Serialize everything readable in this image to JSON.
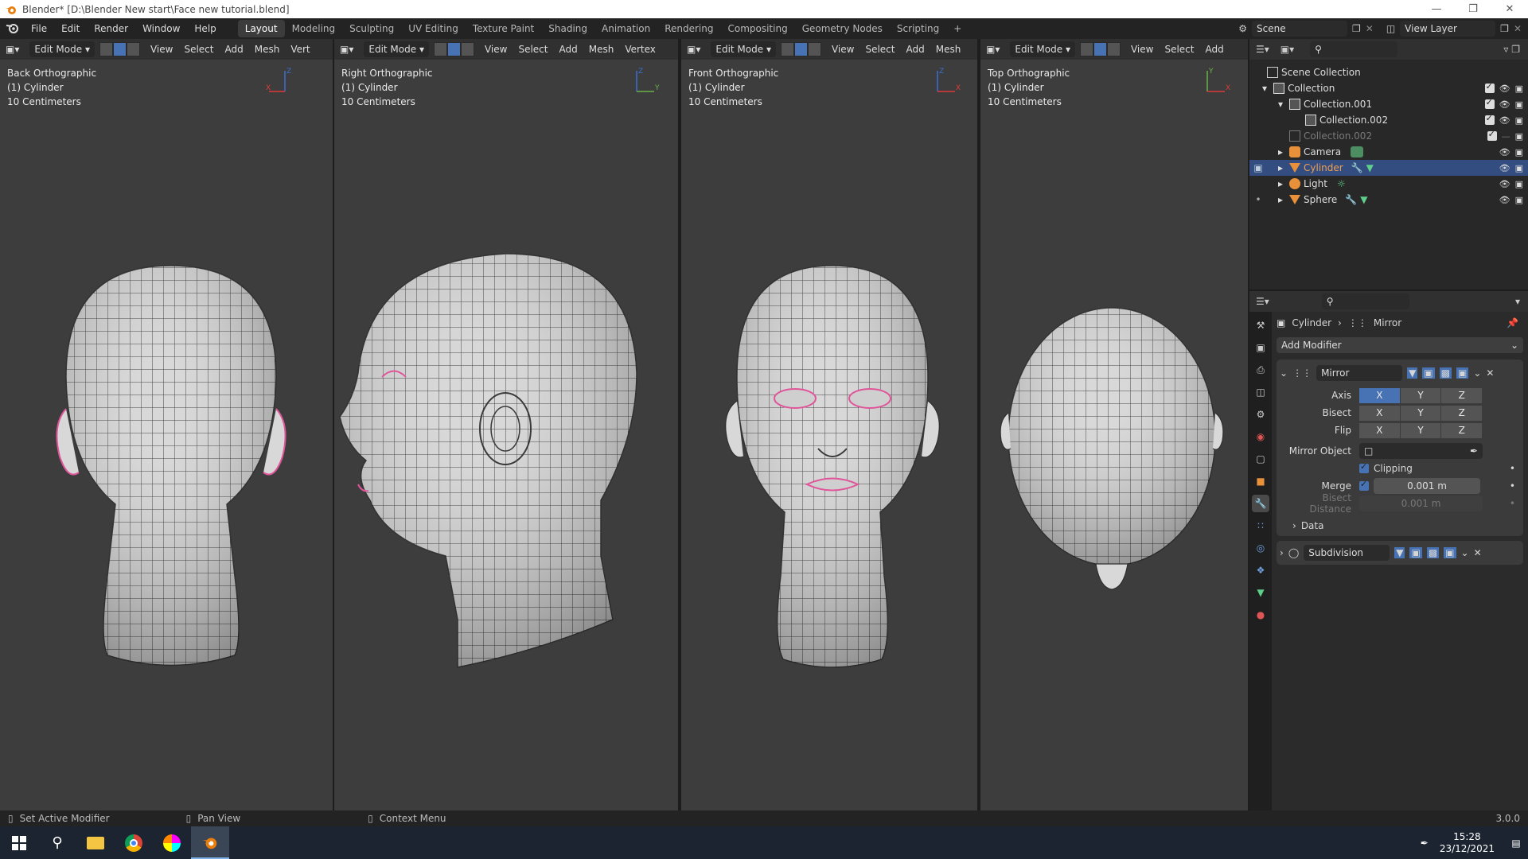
{
  "window": {
    "title": "Blender* [D:\\Blender New start\\Face new tutorial.blend]"
  },
  "menu": [
    "File",
    "Edit",
    "Render",
    "Window",
    "Help"
  ],
  "workspaces": [
    "Layout",
    "Modeling",
    "Sculpting",
    "UV Editing",
    "Texture Paint",
    "Shading",
    "Animation",
    "Rendering",
    "Compositing",
    "Geometry Nodes",
    "Scripting",
    "+"
  ],
  "scene": {
    "name": "Scene",
    "view_layer": "View Layer"
  },
  "viewports": [
    {
      "mode": "Edit Mode",
      "menus": [
        "View",
        "Select",
        "Add",
        "Mesh",
        "Vert"
      ],
      "view": "Back Orthographic",
      "object": "(1) Cylinder",
      "scale": "10 Centimeters",
      "axes": [
        "Z",
        "X"
      ]
    },
    {
      "mode": "Edit Mode",
      "menus": [
        "View",
        "Select",
        "Add",
        "Mesh",
        "Vertex"
      ],
      "view": "Right Orthographic",
      "object": "(1) Cylinder",
      "scale": "10 Centimeters",
      "axes": [
        "Z",
        "Y"
      ]
    },
    {
      "mode": "Edit Mode",
      "menus": [
        "View",
        "Select",
        "Add",
        "Mesh"
      ],
      "view": "Front Orthographic",
      "object": "(1) Cylinder",
      "scale": "10 Centimeters",
      "axes": [
        "Z",
        "X"
      ]
    },
    {
      "mode": "Edit Mode",
      "menus": [
        "View",
        "Select",
        "Add"
      ],
      "view": "Top Orthographic",
      "object": "(1) Cylinder",
      "scale": "10 Centimeters",
      "axes": [
        "Y",
        "X"
      ]
    }
  ],
  "outliner": {
    "root": "Scene Collection",
    "items": [
      {
        "name": "Collection",
        "type": "collection"
      },
      {
        "name": "Collection.001",
        "type": "collection"
      },
      {
        "name": "Collection.002",
        "type": "collection"
      },
      {
        "name": "Collection.002",
        "type": "collection-disabled"
      },
      {
        "name": "Camera",
        "type": "camera"
      },
      {
        "name": "Cylinder",
        "type": "mesh",
        "selected": true
      },
      {
        "name": "Light",
        "type": "light"
      },
      {
        "name": "Sphere",
        "type": "mesh"
      }
    ]
  },
  "properties": {
    "breadcrumb": [
      "Cylinder",
      "Mirror"
    ],
    "add_modifier": "Add Modifier",
    "mirror": {
      "name": "Mirror",
      "axis_label": "Axis",
      "bisect_label": "Bisect",
      "flip_label": "Flip",
      "xyz": [
        "X",
        "Y",
        "Z"
      ],
      "mirror_object_label": "Mirror Object",
      "clipping_label": "Clipping",
      "merge_label": "Merge",
      "merge_value": "0.001 m",
      "bisect_distance_label": "Bisect Distance",
      "bisect_distance_value": "0.001 m",
      "data_label": "Data"
    },
    "subdivision": {
      "name": "Subdivision"
    }
  },
  "status": {
    "left": "Set Active Modifier",
    "mid": "Pan View",
    "right": "Context Menu",
    "version": "3.0.0"
  },
  "taskbar": {
    "time": "15:28",
    "date": "23/12/2021"
  },
  "colors": {
    "accent": "#4772b3",
    "selected_row": "#334d80",
    "viewport_bg": "#3d3d3d",
    "seam": "#e0559a"
  }
}
